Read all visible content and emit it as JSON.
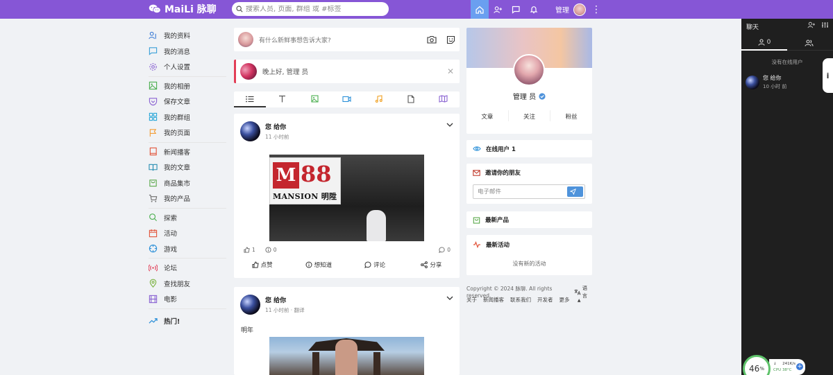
{
  "app": {
    "name": "MaiLi 脉聊"
  },
  "search": {
    "placeholder": "搜索人员, 页面, 群组 或 #标签"
  },
  "user": {
    "name": "管理"
  },
  "sidebar": {
    "items": [
      {
        "label": "我的资料",
        "icon": "user-sliders-icon",
        "color": "#3a7bd5"
      },
      {
        "label": "我的消息",
        "icon": "message-icon",
        "color": "#3aa0d8"
      },
      {
        "label": "个人设置",
        "icon": "gear-icon",
        "color": "#8a63d2"
      },
      {
        "label": "我的相册",
        "icon": "image-icon",
        "color": "#4caf50"
      },
      {
        "label": "保存文章",
        "icon": "pocket-icon",
        "color": "#8a63d2"
      },
      {
        "label": "我的群组",
        "icon": "grid-icon",
        "color": "#29a6d8"
      },
      {
        "label": "我的页面",
        "icon": "flag-icon",
        "color": "#f39c34"
      },
      {
        "label": "新闻播客",
        "icon": "book-icon",
        "color": "#e2543a"
      },
      {
        "label": "我的文章",
        "icon": "open-book-icon",
        "color": "#2a8fb3"
      },
      {
        "label": "商品集市",
        "icon": "shopping-bag-icon",
        "color": "#5aa84a"
      },
      {
        "label": "我的产品",
        "icon": "cart-icon",
        "color": "#6e6e6e"
      },
      {
        "label": "探索",
        "icon": "search-icon",
        "color": "#4caf50"
      },
      {
        "label": "活动",
        "icon": "calendar-icon",
        "color": "#e2543a"
      },
      {
        "label": "游戏",
        "icon": "crosshair-icon",
        "color": "#2a8fd8"
      },
      {
        "label": "论坛",
        "icon": "broadcast-icon",
        "color": "#e23e57"
      },
      {
        "label": "查找朋友",
        "icon": "map-pin-icon",
        "color": "#7cb342"
      },
      {
        "label": "电影",
        "icon": "film-icon",
        "color": "#8a63d2"
      },
      {
        "label": "热门!",
        "icon": "trending-icon",
        "color": "#2a8fd8"
      }
    ]
  },
  "composer": {
    "placeholder": "有什么新鲜事想告诉大家?"
  },
  "greeting": {
    "text": "晚上好, 管理 员"
  },
  "posts": [
    {
      "author": "您 给你",
      "time": "11 小时前",
      "likes": "1",
      "wonders": "0",
      "comments": "0",
      "text": ""
    },
    {
      "author": "您 给你",
      "time": "11 小时前 · 翻译",
      "text": "明年"
    }
  ],
  "image_text": {
    "sign": "M",
    "number": "88",
    "mansion": "MANSION 明陞"
  },
  "post_actions": {
    "like": "点赞",
    "wonder": "想知道",
    "comment": "评论",
    "share": "分享"
  },
  "profile": {
    "name": "管理 员",
    "tabs": [
      "文章",
      "关注",
      "粉丝"
    ]
  },
  "widgets": {
    "online": "在线用户 1",
    "invite": "邀请你的朋友",
    "email_placeholder": "电子邮件",
    "products": "最新产品",
    "activity": "最新活动",
    "no_activity": "没有新的活动"
  },
  "footer": {
    "copyright": "Copyright © 2024 脉聊. All rights reserved.",
    "language": "语言",
    "links": [
      "关于",
      "新闻播客",
      "联系我们",
      "开发者",
      "更多"
    ]
  },
  "chat": {
    "title": "聊天",
    "online_count": "0",
    "no_online": "没有在线用户",
    "user": {
      "name": "您 给你",
      "time": "10 小时 前"
    }
  },
  "side_tab": "i",
  "cpu": {
    "percent": "46",
    "unit": "%",
    "speed": "241K/s",
    "label": "CPU",
    "temp": "38°C"
  },
  "colors": {
    "brand": "#8656d6",
    "accent": "#4f93db",
    "chat_bg": "#1f1f1f"
  }
}
